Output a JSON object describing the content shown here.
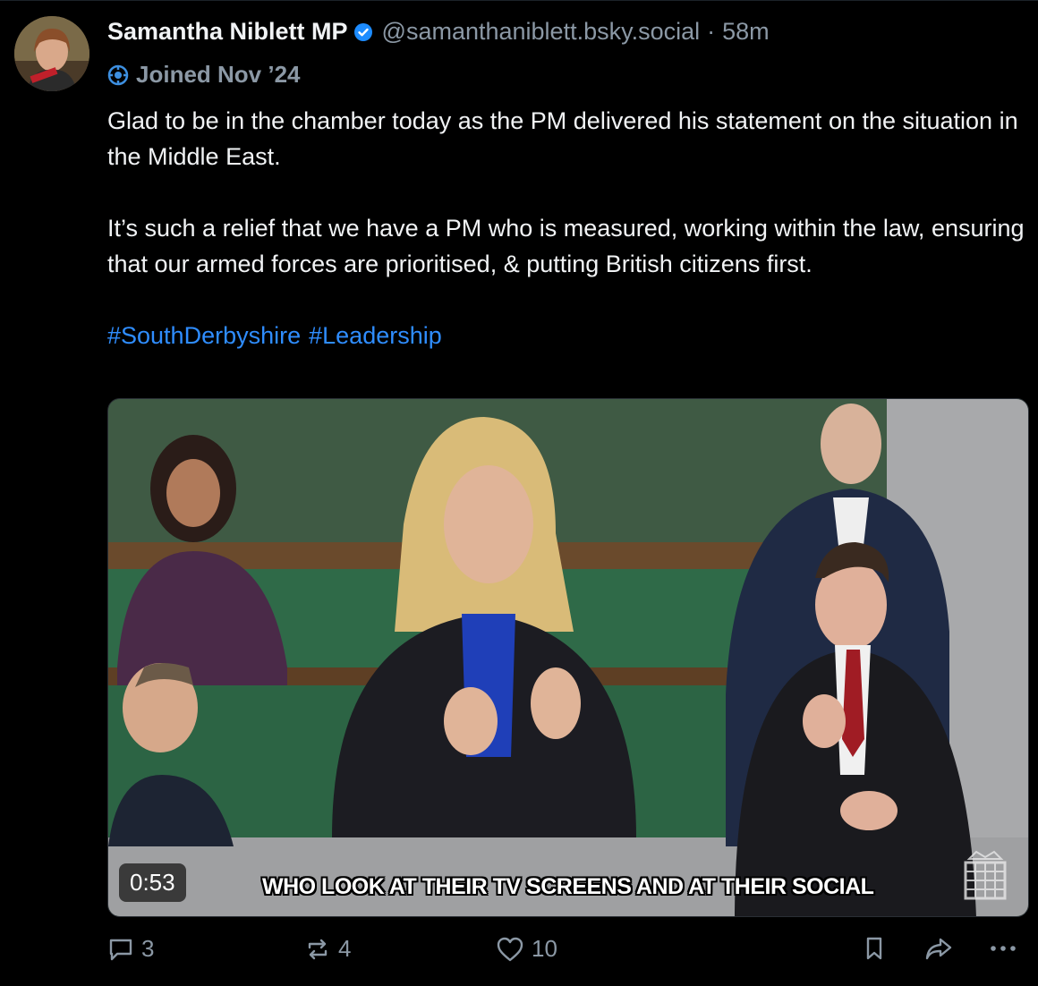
{
  "post": {
    "author_name": "Samantha Niblett MP",
    "handle": "@samanthaniblett.bsky.social",
    "separator": "·",
    "time_ago": "58m",
    "joined": "Joined Nov ’24",
    "text_para1": "Glad to be in the chamber today as the PM delivered his statement on the situation in the Middle East.",
    "text_para2": "It’s such a relief that we have a PM who is measured, working within the law, ensuring that our armed forces are prioritised, & putting British citizens first.",
    "hashtags": [
      "#SouthDerbyshire",
      "#Leadership"
    ]
  },
  "video": {
    "duration": "0:53",
    "caption": "WHO LOOK AT THEIR TV SCREENS AND AT THEIR SOCIAL"
  },
  "actions": {
    "replies": "3",
    "reposts": "4",
    "likes": "10"
  },
  "icons": {
    "verified": "verified-check-icon",
    "joined": "new-user-badge-icon",
    "reply": "reply-bubble-icon",
    "repost": "repost-icon",
    "like": "heart-icon",
    "bookmark": "bookmark-icon",
    "share": "share-icon",
    "more": "more-options-icon"
  },
  "colors": {
    "background": "#000000",
    "text": "#f1f3f5",
    "muted": "#8b98a5",
    "link": "#2f8dff",
    "verified": "#1d8cff"
  }
}
